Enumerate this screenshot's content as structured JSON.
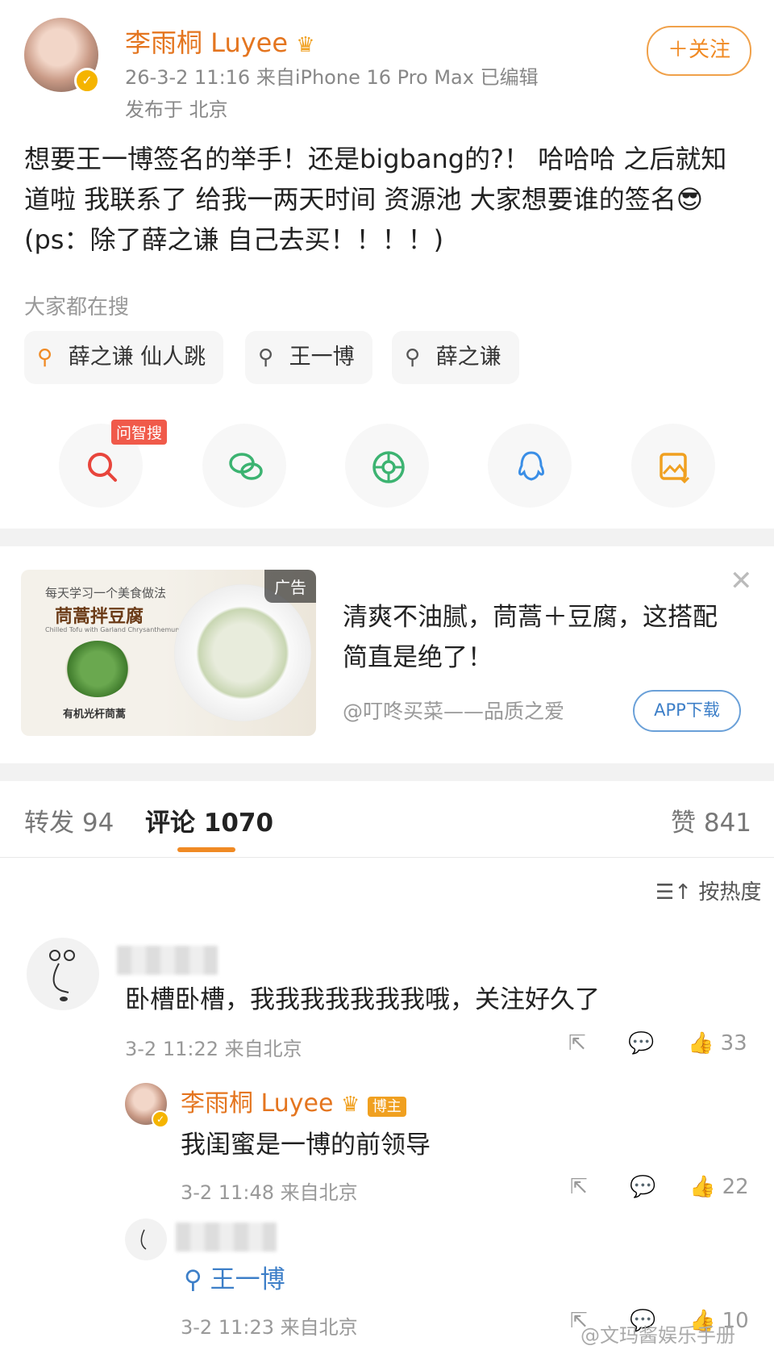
{
  "post": {
    "author": "李雨桐 Luyee",
    "crown_icon": "crown-icon",
    "meta": "26-3-2 11:16  来自iPhone 16 Pro Max  已编辑",
    "location": "发布于 北京",
    "follow_label": "＋关注",
    "text": "想要王一博签名的举手！还是bigbang的?！ 哈哈哈 之后就知道啦 我联系了 给我一两天时间 资源池 大家想要谁的签名😎(ps：除了薛之谦 自己去买！！！！)"
  },
  "hot_search": {
    "label": "大家都在搜",
    "items": [
      "薛之谦 仙人跳",
      "王一博",
      "薛之谦"
    ]
  },
  "share": {
    "ai_badge": "问智搜",
    "buttons": [
      "ai-search-icon",
      "wechat-icon",
      "moments-icon",
      "qq-icon",
      "save-image-icon"
    ]
  },
  "ad": {
    "tag": "广告",
    "image_title": "每天学习一个美食做法",
    "image_dish": "茼蒿拌豆腐",
    "image_sub": "Chilled Tofu with Garland Chrysanthemum",
    "image_caption": "有机光杆茼蒿",
    "title": "清爽不油腻，茼蒿＋豆腐，这搭配简直是绝了！",
    "source": "@叮咚买菜——品质之爱",
    "button": "APP下载"
  },
  "tabs": {
    "repost": "转发 94",
    "comment": "评论 1070",
    "like": "赞 841"
  },
  "sort_label": "按热度",
  "comments": [
    {
      "text": "卧槽卧槽，我我我我我我我哦，关注好久了",
      "meta": "3-2 11:22  来自北京",
      "likes": "33"
    }
  ],
  "reply": {
    "author": "李雨桐 Luyee",
    "host_badge": "博主",
    "text": "我闺蜜是一博的前领导",
    "meta": "3-2 11:48  来自北京",
    "likes": "22"
  },
  "reply2": {
    "search_text": "王一博",
    "meta": "3-2 11:23  来自北京",
    "likes": "10"
  },
  "watermark": "@文玛酱娱乐手册",
  "colors": {
    "accent": "#f08a24",
    "author": "#e4751f",
    "link": "#3d7fc8"
  }
}
